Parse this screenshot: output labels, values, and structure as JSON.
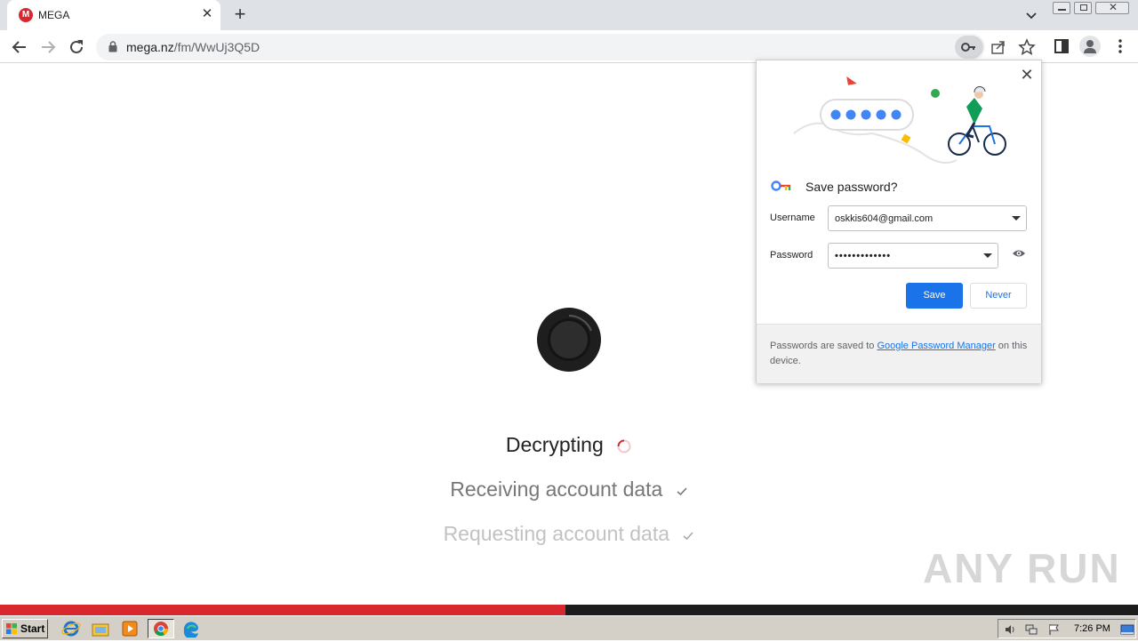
{
  "browser": {
    "tab_title": "MEGA",
    "tab_favicon_letter": "M",
    "url_host": "mega.nz",
    "url_path": "/fm/WwUj3Q5D"
  },
  "page": {
    "steps": [
      {
        "label": "Decrypting",
        "state": "in-progress"
      },
      {
        "label": "Receiving account data",
        "state": "done"
      },
      {
        "label": "Requesting account data",
        "state": "done"
      }
    ],
    "progress": 0.497
  },
  "password_popup": {
    "title": "Save password?",
    "username_label": "Username",
    "username_value": "oskkis604@gmail.com",
    "password_label": "Password",
    "password_value": "•••••••••••••",
    "save_label": "Save",
    "never_label": "Never",
    "footer_prefix": "Passwords are saved to ",
    "footer_link": "Google Password Manager",
    "footer_suffix": " on this device."
  },
  "watermark": "ANY RUN",
  "taskbar": {
    "start_label": "Start",
    "clock": "7:26 PM"
  },
  "colors": {
    "mega_red": "#d9272e",
    "google_blue": "#1a73e8",
    "taskbar": "#d4d0c8"
  }
}
